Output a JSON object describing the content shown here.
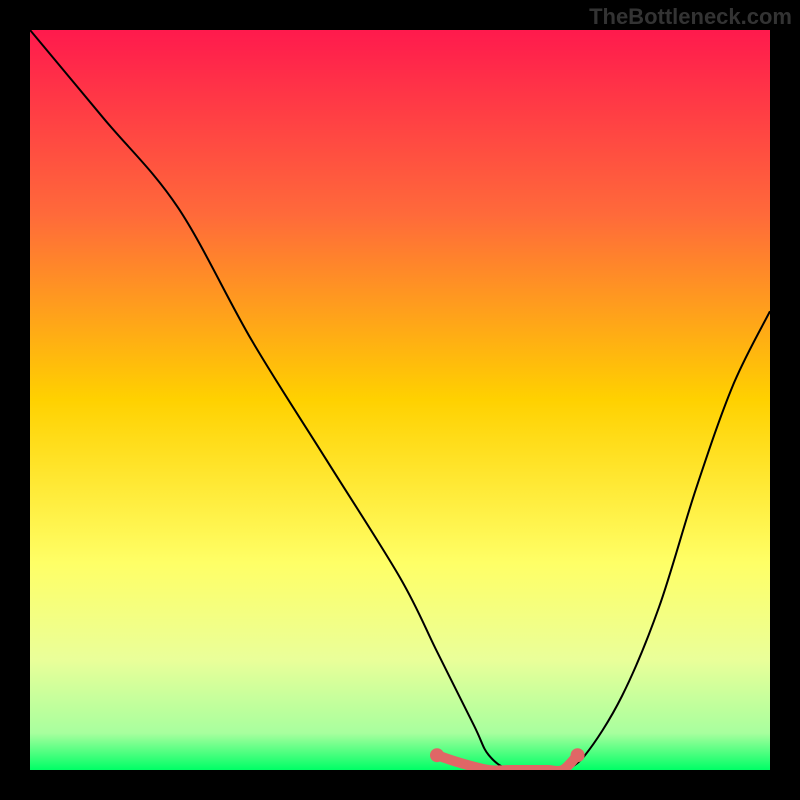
{
  "watermark": "TheBottleneck.com",
  "chart_data": {
    "type": "line",
    "title": "",
    "xlabel": "",
    "ylabel": "",
    "xlim": [
      0,
      100
    ],
    "ylim": [
      0,
      100
    ],
    "background_gradient": {
      "stops": [
        {
          "offset": 0,
          "color": "#ff1a4d"
        },
        {
          "offset": 25,
          "color": "#ff6a3a"
        },
        {
          "offset": 50,
          "color": "#ffd100"
        },
        {
          "offset": 72,
          "color": "#ffff66"
        },
        {
          "offset": 85,
          "color": "#eaff99"
        },
        {
          "offset": 95,
          "color": "#a8ff9e"
        },
        {
          "offset": 100,
          "color": "#00ff66"
        }
      ]
    },
    "series": [
      {
        "name": "bottleneck-curve",
        "color": "#000000",
        "x": [
          0,
          10,
          20,
          30,
          40,
          50,
          55,
          60,
          62,
          65,
          70,
          72,
          75,
          80,
          85,
          90,
          95,
          100
        ],
        "y": [
          100,
          88,
          76,
          58,
          42,
          26,
          16,
          6,
          2,
          0,
          0,
          0,
          2,
          10,
          22,
          38,
          52,
          62
        ]
      },
      {
        "name": "highlight-segment",
        "color": "#e06666",
        "x": [
          55,
          58,
          62,
          65,
          68,
          70,
          72,
          74
        ],
        "y": [
          2,
          1,
          0,
          0,
          0,
          0,
          0,
          2
        ]
      }
    ],
    "highlight_endpoints": [
      {
        "x": 55,
        "y": 2
      },
      {
        "x": 74,
        "y": 2
      }
    ]
  }
}
